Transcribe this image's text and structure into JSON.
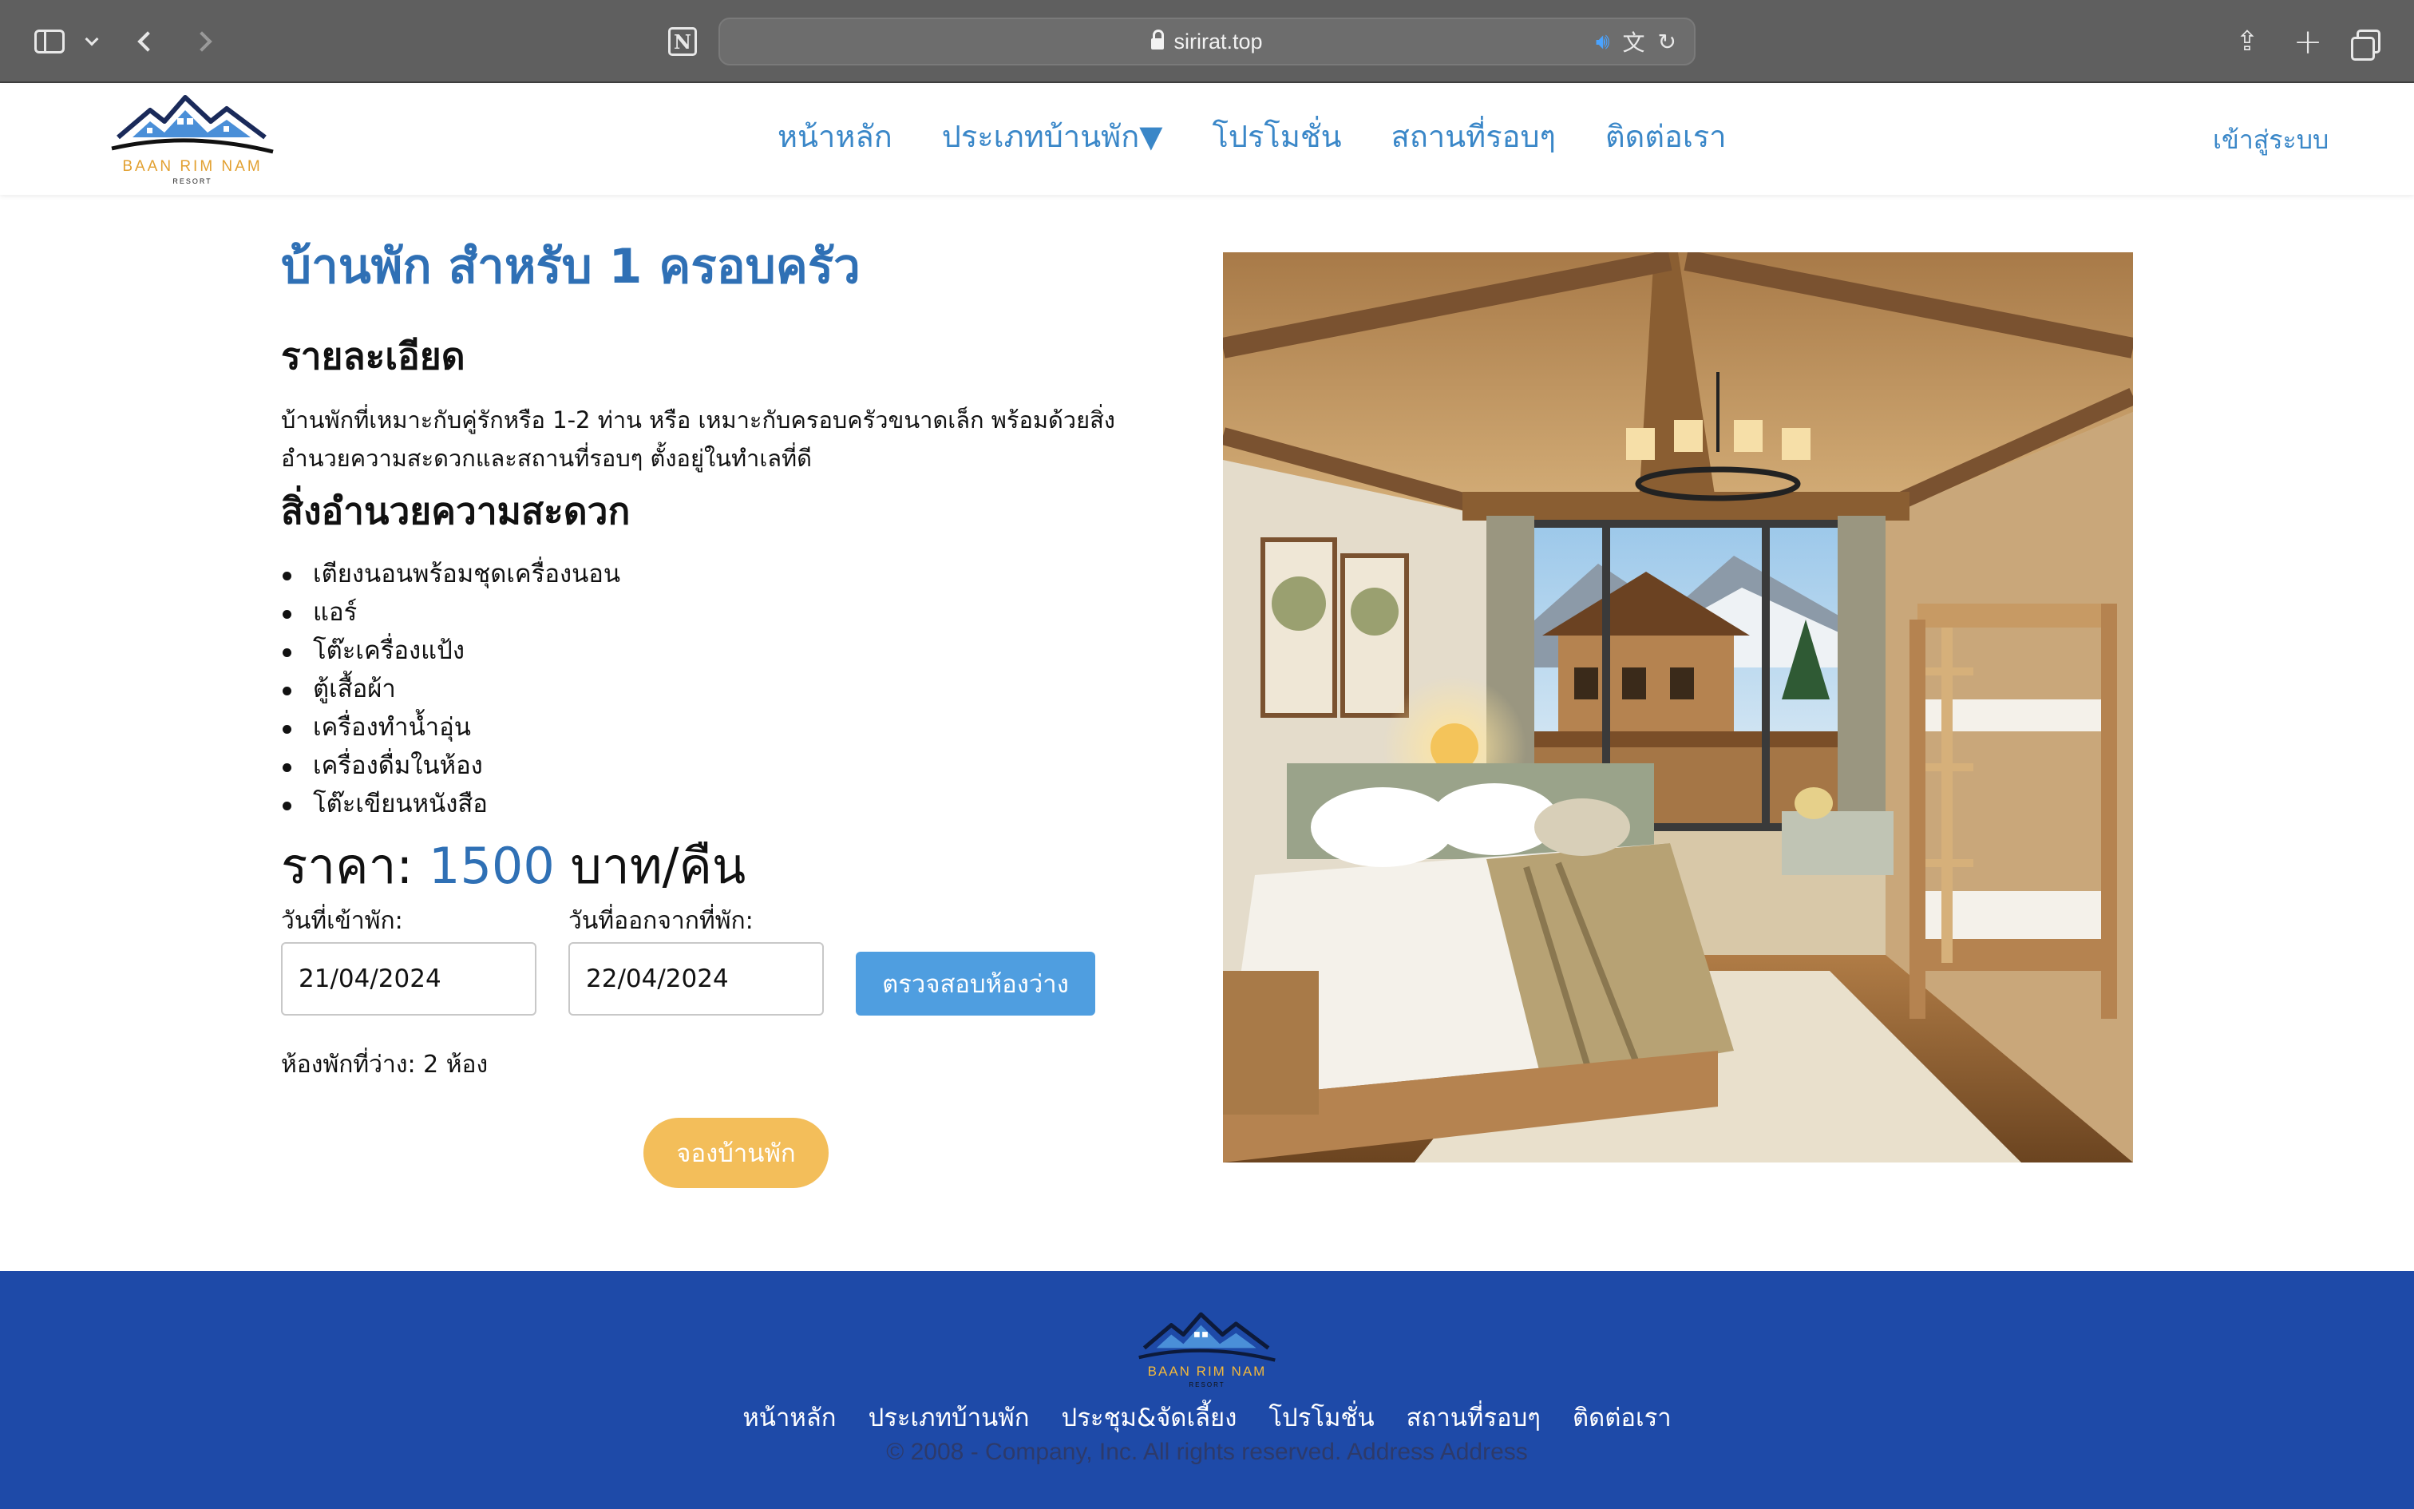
{
  "browser": {
    "url": "sirirat.top"
  },
  "header": {
    "logo_text": "BAAN RIM NAM",
    "logo_sub": "RESORT",
    "nav": [
      "หน้าหลัก",
      "ประเภทบ้านพัก▼",
      "โปรโมชั่น",
      "สถานที่รอบๆ",
      "ติดต่อเรา"
    ],
    "login": "เข้าสู่ระบบ"
  },
  "room": {
    "title": "บ้านพัก สำหรับ 1 ครอบครัว",
    "detail_heading": "รายละเอียด",
    "description": "บ้านพักที่เหมาะกับคู่รักหรือ 1-2 ท่าน หรือ เหมาะกับครอบครัวขนาดเล็ก พร้อมด้วยสิ่งอำนวยความสะดวกและสถานที่รอบๆ ตั้งอยู่ในทำเลที่ดี",
    "amenities_heading": "สิ่งอำนวยความสะดวก",
    "amenities": [
      "เตียงนอนพร้อมชุดเครื่องนอน",
      "แอร์",
      "โต๊ะเครื่องแป้ง",
      "ตู้เสื้อผ้า",
      "เครื่องทำน้ำอุ่น",
      "เครื่องดื่มในห้อง",
      "โต๊ะเขียนหนังสือ"
    ],
    "price_label": "ราคา:",
    "price_value": "1500",
    "price_unit": "บาท/คืน"
  },
  "booking": {
    "checkin_label": "วันที่เข้าพัก:",
    "checkin_value": "21/04/2024",
    "checkout_label": "วันที่ออกจากที่พัก:",
    "checkout_value": "22/04/2024",
    "check_button": "ตรวจสอบห้องว่าง",
    "availability": "ห้องพักที่ว่าง: 2 ห้อง",
    "book_button": "จองบ้านพัก"
  },
  "footer": {
    "logo_text": "BAAN RIM NAM",
    "logo_sub": "RESORT",
    "nav": [
      "หน้าหลัก",
      "ประเภทบ้านพัก",
      "ประชุม&จัดเลี้ยง",
      "โปรโมชั่น",
      "สถานที่รอบๆ",
      "ติดต่อเรา"
    ],
    "copyright": "© 2008 - Company, Inc. All rights reserved. Address Address"
  },
  "colors": {
    "accent_blue": "#3a87c8",
    "button_blue": "#4f9ee0",
    "book_yellow": "#f3be5a",
    "footer_blue": "#1e4aa8"
  }
}
